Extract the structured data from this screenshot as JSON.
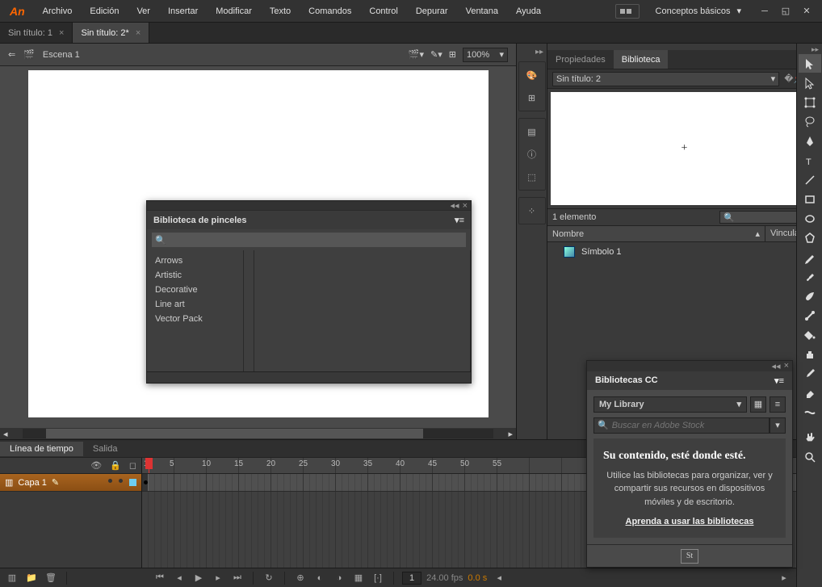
{
  "app": {
    "logo": "An"
  },
  "menu": [
    "Archivo",
    "Edición",
    "Ver",
    "Insertar",
    "Modificar",
    "Texto",
    "Comandos",
    "Control",
    "Depurar",
    "Ventana",
    "Ayuda"
  ],
  "workspace": {
    "label": "Conceptos básicos"
  },
  "docTabs": [
    {
      "label": "Sin título: 1",
      "active": false
    },
    {
      "label": "Sin título: 2*",
      "active": true
    }
  ],
  "scene": {
    "label": "Escena 1",
    "zoom": "100%"
  },
  "brushLibrary": {
    "title": "Biblioteca de pinceles",
    "searchPlaceholder": "",
    "items": [
      "Arrows",
      "Artistic",
      "Decorative",
      "Line art",
      "Vector Pack"
    ]
  },
  "libraryPanel": {
    "tabs": [
      "Propiedades",
      "Biblioteca"
    ],
    "activeTab": 1,
    "docSelect": "Sin título: 2",
    "count": "1 elemento",
    "columns": {
      "name": "Nombre",
      "link": "Vinculación"
    },
    "rows": [
      {
        "name": "Símbolo 1"
      }
    ]
  },
  "ccLibraries": {
    "title": "Bibliotecas CC",
    "select": "My Library",
    "searchPlaceholder": "Buscar en Adobe Stock",
    "emptyHeading": "Su contenido, esté donde esté.",
    "emptyText": "Utilice las bibliotecas para organizar, ver y compartir sus recursos en dispositivos móviles y de escritorio.",
    "learnLink": "Aprenda a usar las bibliotecas",
    "stockLabel": "St"
  },
  "timeline": {
    "tabs": [
      "Línea de tiempo",
      "Salida"
    ],
    "activeTab": 0,
    "layer": "Capa 1",
    "ruler": [
      1,
      5,
      10,
      15,
      20,
      25,
      30,
      35,
      40,
      45,
      50,
      55
    ],
    "fps": "24.00 fps",
    "currentFrame": "1",
    "currentTime": "0.0 s"
  }
}
